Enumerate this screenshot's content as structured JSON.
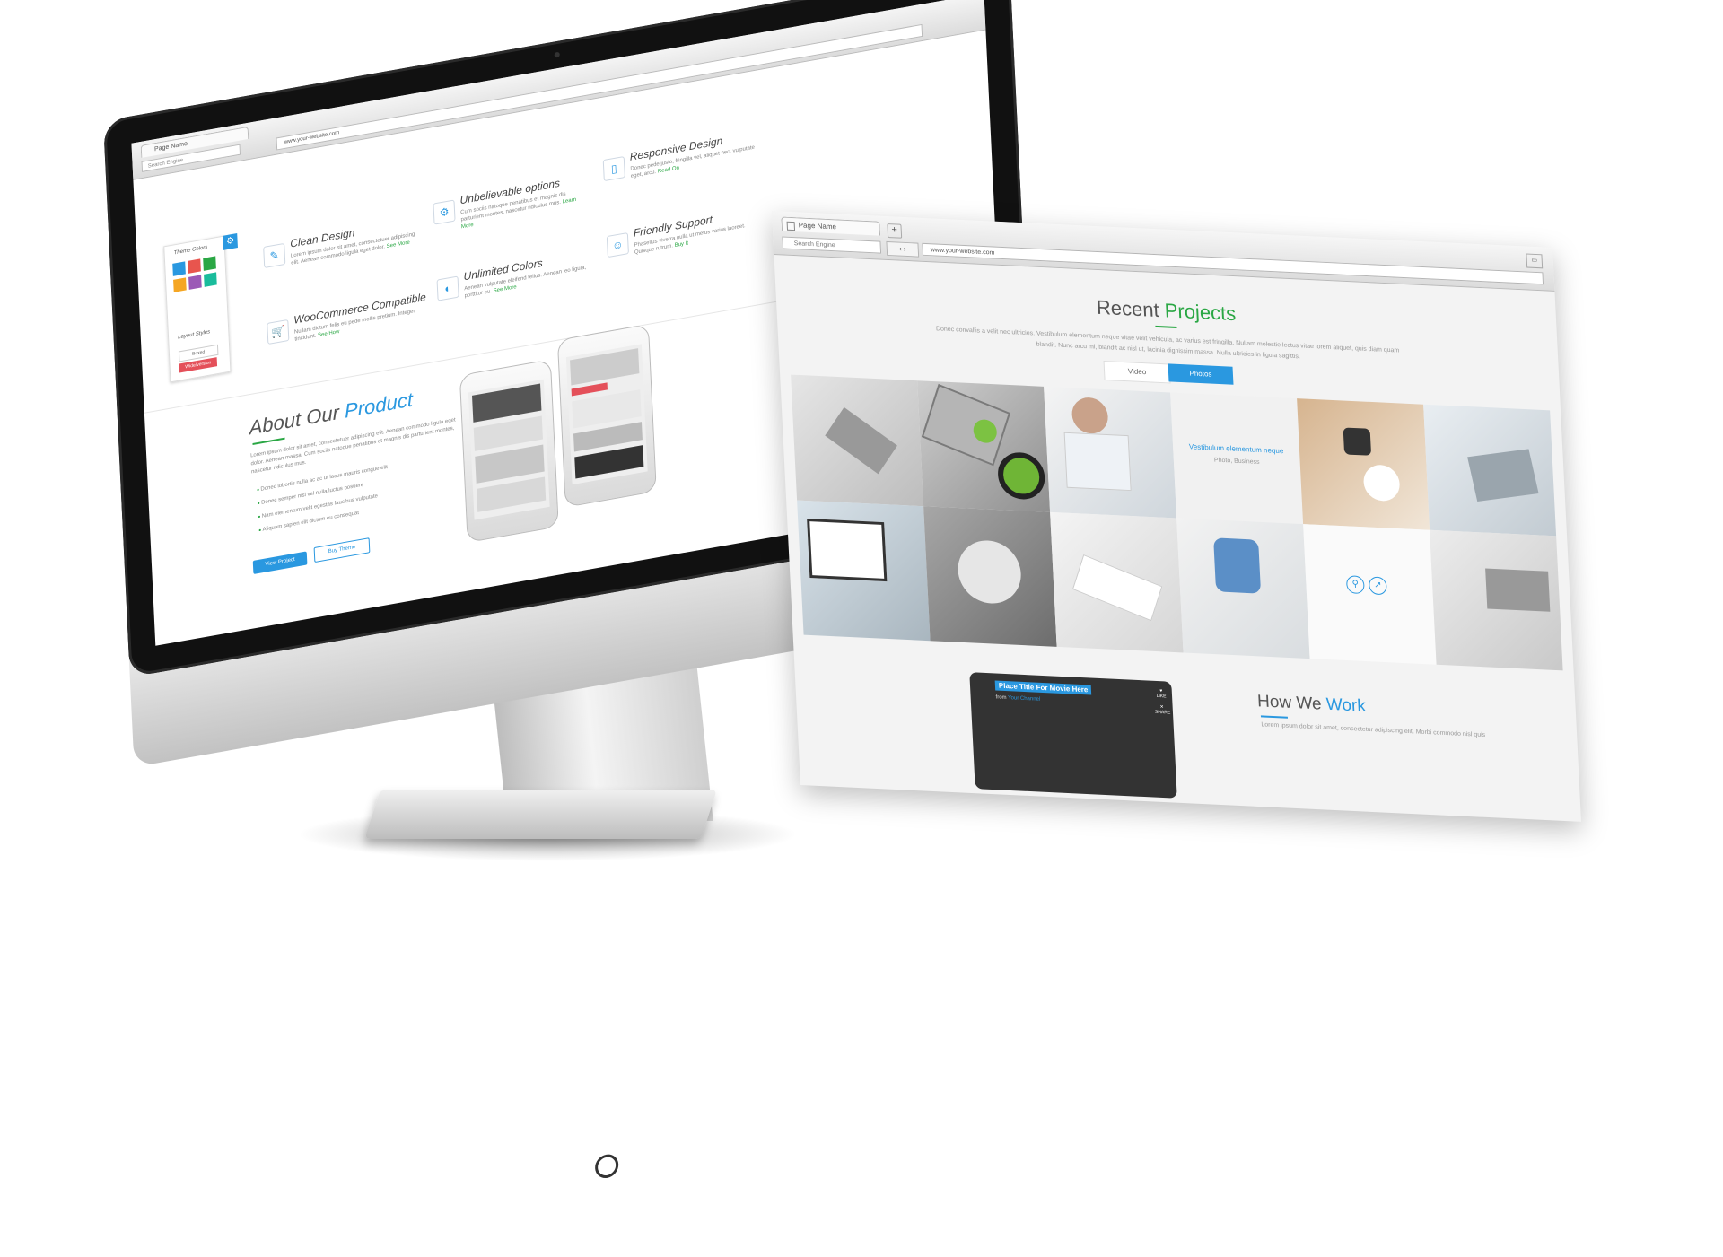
{
  "desktop_browser": {
    "tab_title": "Page Name",
    "search_placeholder": "Search Engine",
    "address": "www.your-website.com",
    "theme_panel": {
      "title": "Theme Colors",
      "layout_title": "Layout Styles",
      "boxed_label": "Boxed",
      "wide_label": "Wide/version",
      "swatches": [
        "#2a98e0",
        "#e8554e",
        "#2aa744",
        "#f5a623",
        "#9b59b6",
        "#1abc9c"
      ]
    },
    "features": [
      {
        "title": "Clean Design",
        "text": "Lorem ipsum dolor sit amet, consectetuer adipiscing elit. Aenean commodo ligula eget dolor.",
        "link": "See More"
      },
      {
        "title": "Unbelievable options",
        "text": "Cum sociis natoque penatibus et magnis dis parturient montes, nascetur ridiculus mus.",
        "link": "Learn More"
      },
      {
        "title": "Responsive Design",
        "text": "Donec pede justo, fringilla vel, aliquet nec, vulputate eget, arcu.",
        "link": "Read On"
      },
      {
        "title": "WooCommerce Compatible",
        "text": "Nullam dictum felis eu pede mollis pretium. Integer tincidunt.",
        "link": "See How"
      },
      {
        "title": "Unlimited Colors",
        "text": "Aenean vulputate eleifend tellus. Aenean leo ligula, porttitor eu.",
        "link": "See More"
      },
      {
        "title": "Friendly Support",
        "text": "Phasellus viverra nulla ut metus varius laoreet. Quisque rutrum.",
        "link": "Buy It"
      }
    ],
    "about": {
      "title_a": "About Our",
      "title_b": "Product",
      "text": "Lorem ipsum dolor sit amet, consectetuer adipiscing elit. Aenean commodo ligula eget dolor. Aenean massa. Cum sociis natoque penatibus et magnis dis parturient montes, nascetur ridiculus mus.",
      "bullets": [
        "Donec lobortis nulla ac ac ut lacus mauris congue elit",
        "Donec semper nisl vel nulla luctus posuere",
        "Nam elementum velit egestas faucibus vulputate",
        "Aliquam sapien elit dictum eu consequat"
      ],
      "btn_primary": "View Project",
      "btn_secondary": "Buy Theme"
    }
  },
  "project_browser": {
    "tab_title": "Page Name",
    "search_placeholder": "Search Engine",
    "address": "www.your-website.com",
    "section_title_a": "Recent",
    "section_title_b": "Projects",
    "section_text": "Donec convallis a velit nec ultricies. Vestibulum elementum neque vitae velit vehicula, ac varius est fringilla. Nullam molestie lectus vitae lorem aliquet, quis diam quam blandit. Nunc arcu mi, blandit ac nisl ut, lacinia dignissim massa. Nulla ultricies in ligula sagittis.",
    "toggle_video": "Video",
    "toggle_photos": "Photos",
    "hover_title": "Vestibulum elementum neque",
    "hover_sub": "Photo, Business",
    "how_title_a": "How We",
    "how_title_b": "Work",
    "how_text": "Lorem ipsum dolor sit amet, consectetur adipiscing elit. Morbi commodo nisl quis",
    "video": {
      "title": "Place Title For Movie Here",
      "from": "from",
      "channel": "Your Channel",
      "like": "LIKE",
      "share": "SHARE"
    }
  },
  "colors": {
    "accent_blue": "#2a98e0",
    "accent_green": "#2aa744",
    "accent_red": "#e4505a"
  }
}
